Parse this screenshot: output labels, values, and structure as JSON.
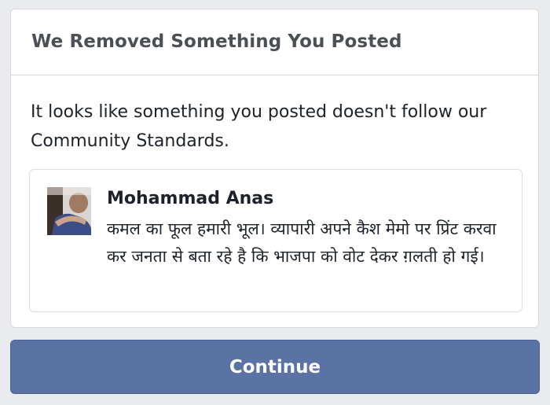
{
  "dialog": {
    "title": "We Removed Something You Posted",
    "message": "It looks like something you posted doesn't follow our Community Standards."
  },
  "post": {
    "author": "Mohammad Anas",
    "text": "कमल का फूल हमारी भूल। व्यापारी अपने कैश मेमो पर प्रिंट करवा कर जनता से बता रहे है कि भाजपा को वोट देकर ग़लती हो गई।"
  },
  "actions": {
    "continue_label": "Continue"
  },
  "colors": {
    "background": "#e9ebee",
    "button": "#5b72a5",
    "title_text": "#4b4f56",
    "body_text": "#1d2129"
  }
}
